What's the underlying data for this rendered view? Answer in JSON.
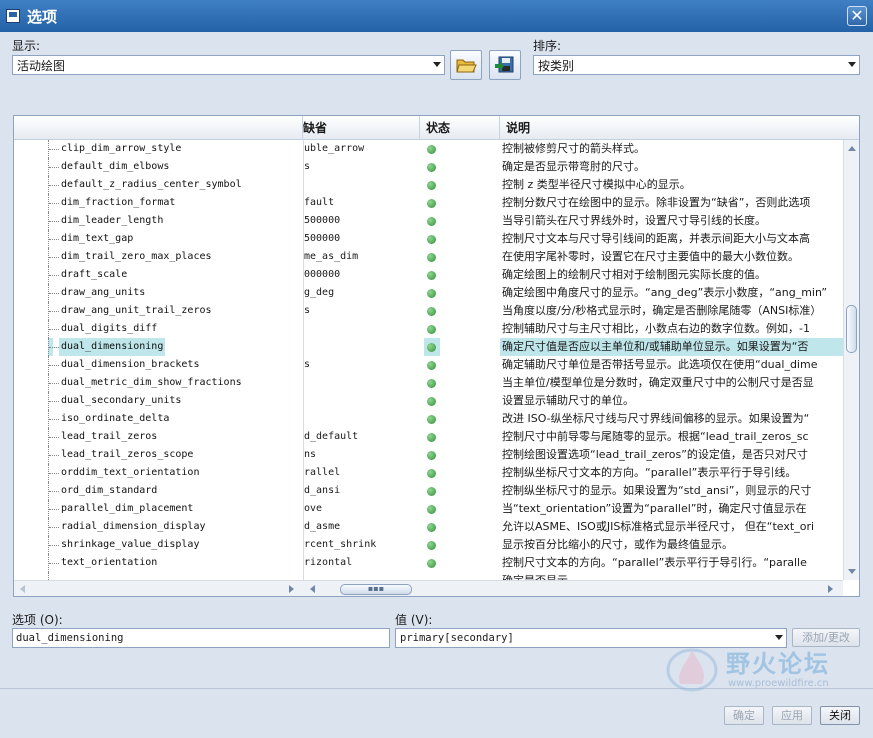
{
  "window": {
    "title": "选项",
    "close_glyph": "✕"
  },
  "display": {
    "label": "显示:",
    "value": "活动绘图"
  },
  "sort": {
    "label": "排序:",
    "value": "按类别"
  },
  "toolbar": {
    "open_icon": "folder-open-icon",
    "save_icon": "save-icon"
  },
  "table": {
    "columns": {
      "name": "",
      "default": "缺省",
      "status": "状态",
      "description": "说明"
    },
    "rows": [
      {
        "name": "clip_dim_arrow_style",
        "default": "uble_arrow",
        "desc": "控制被修剪尺寸的箭头样式。"
      },
      {
        "name": "default_dim_elbows",
        "default": "s",
        "desc": "确定是否显示带弯肘的尺寸。"
      },
      {
        "name": "default_z_radius_center_symbol",
        "default": "",
        "desc": "控制 z 类型半径尺寸模拟中心的显示。"
      },
      {
        "name": "dim_fraction_format",
        "default": "fault",
        "desc": "控制分数尺寸在绘图中的显示。除非设置为“缺省”，否则此选项"
      },
      {
        "name": "dim_leader_length",
        "default": "500000",
        "desc": "当导引箭头在尺寸界线外时，设置尺寸导引线的长度。"
      },
      {
        "name": "dim_text_gap",
        "default": "500000",
        "desc": "控制尺寸文本与尺寸导引线间的距离，并表示间距大小与文本高"
      },
      {
        "name": "dim_trail_zero_max_places",
        "default": "me_as_dim",
        "desc": "在使用字尾补零时，设置它在尺寸主要值中的最大小数位数。"
      },
      {
        "name": "draft_scale",
        "default": "000000",
        "desc": "确定绘图上的绘制尺寸相对于绘制图元实际长度的值。"
      },
      {
        "name": "draw_ang_units",
        "default": "g_deg",
        "desc": "确定绘图中角度尺寸的显示。“ang_deg”表示小数度，“ang_min”"
      },
      {
        "name": "draw_ang_unit_trail_zeros",
        "default": "s",
        "desc": "当角度以度/分/秒格式显示时，确定是否删除尾随零（ANSI标准）"
      },
      {
        "name": "dual_digits_diff",
        "default": "",
        "desc": "控制辅助尺寸与主尺寸相比，小数点右边的数字位数。例如，-1"
      },
      {
        "name": "dual_dimensioning",
        "default": "",
        "desc": "确定尺寸值是否应以主单位和/或辅助单位显示。如果设置为“否",
        "selected": true
      },
      {
        "name": "dual_dimension_brackets",
        "default": "s",
        "desc": "确定辅助尺寸单位是否带括号显示。此选项仅在使用“dual_dime"
      },
      {
        "name": "dual_metric_dim_show_fractions",
        "default": "",
        "desc": "当主单位/模型单位是分数时，确定双重尺寸中的公制尺寸是否显"
      },
      {
        "name": "dual_secondary_units",
        "default": "",
        "desc": "设置显示辅助尺寸的单位。"
      },
      {
        "name": "iso_ordinate_delta",
        "default": "",
        "desc": "改进 ISO-纵坐标尺寸线与尺寸界线间偏移的显示。如果设置为“"
      },
      {
        "name": "lead_trail_zeros",
        "default": "d_default",
        "desc": "控制尺寸中前导零与尾随零的显示。根据“lead_trail_zeros_sc"
      },
      {
        "name": "lead_trail_zeros_scope",
        "default": "ns",
        "desc": "控制绘图设置选项“lead_trail_zeros”的设定值，是否只对尺寸"
      },
      {
        "name": "orddim_text_orientation",
        "default": "rallel",
        "desc": "控制纵坐标尺寸文本的方向。“parallel”表示平行于导引线。"
      },
      {
        "name": "ord_dim_standard",
        "default": "d_ansi",
        "desc": "控制纵坐标尺寸的显示。如果设置为“std_ansi”，则显示的尺寸"
      },
      {
        "name": "parallel_dim_placement",
        "default": "ove",
        "desc": "当“text_orientation”设置为“parallel”时，确定尺寸值显示在"
      },
      {
        "name": "radial_dimension_display",
        "default": "d_asme",
        "desc": "允许以ASME、ISO或JIS标准格式显示半径尺寸， 但在“text_ori"
      },
      {
        "name": "shrinkage_value_display",
        "default": "rcent_shrink",
        "desc": "显示按百分比缩小的尺寸，或作为最终值显示。"
      },
      {
        "name": "text_orientation",
        "default": "rizontal",
        "desc": "控制尺寸文本的方向。“parallel”表示平行于导引行。“paralle"
      },
      {
        "name": "",
        "default": "",
        "desc": "确定是否显示…"
      }
    ],
    "status_color": "#3a9a44"
  },
  "option": {
    "label": "选项 (O):",
    "value": "dual_dimensioning"
  },
  "value": {
    "label": "值 (V):",
    "value": "primary[secondary]"
  },
  "buttons": {
    "add_change": "添加/更改",
    "ok": "确定",
    "apply": "应用",
    "close": "关闭"
  },
  "watermark": {
    "text": "野火论坛",
    "url": "www.proewildfire.cn"
  }
}
